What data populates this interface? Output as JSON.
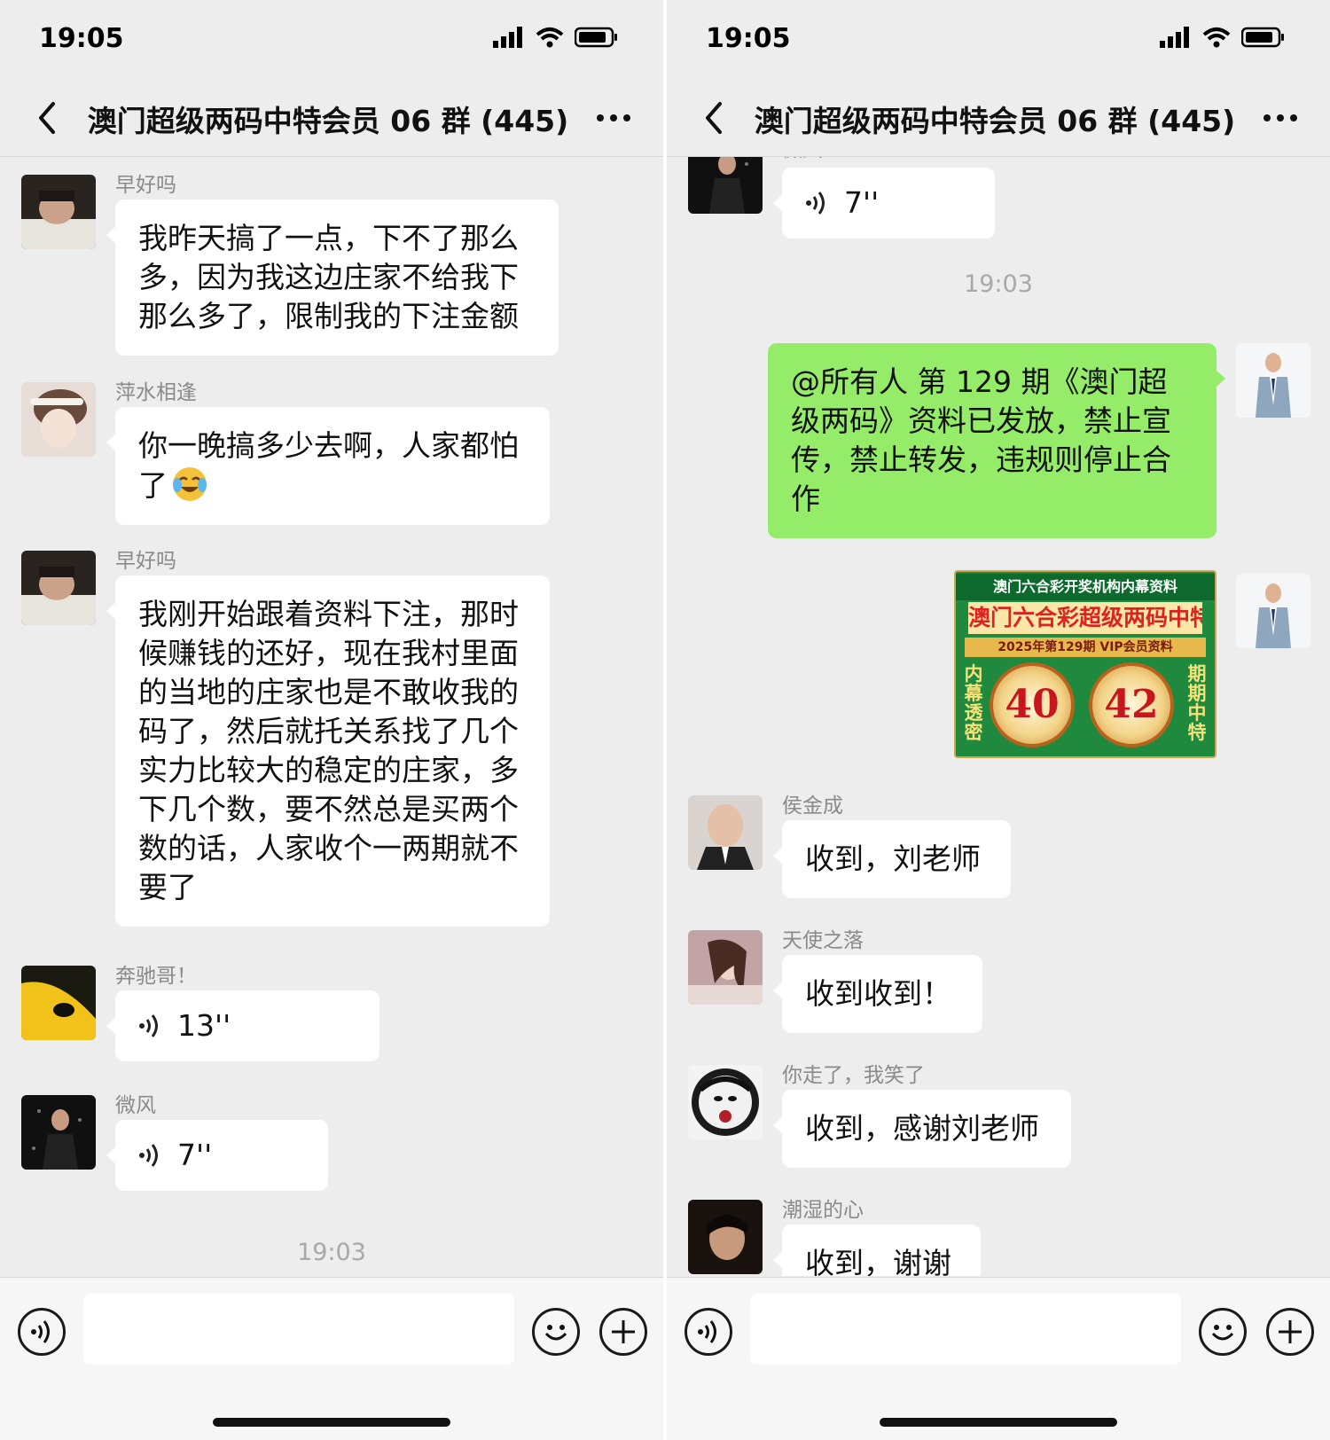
{
  "status": {
    "time": "19:05"
  },
  "header": {
    "title": "澳门超级两码中特会员 06 群 (445)"
  },
  "left": {
    "messages": [
      {
        "sender": "早好吗",
        "text": "我昨天搞了一点，下不了那么多，因为我这边庄家不给我下那么多了，限制我的下注金额"
      },
      {
        "sender": "萍水相逢",
        "text": "你一晚搞多少去啊，人家都怕了"
      },
      {
        "sender": "早好吗",
        "text": "我刚开始跟着资料下注，那时候赚钱的还好，现在我村里面的当地的庄家也是不敢收我的码了，然后就托关系找了几个实力比较大的稳定的庄家，多下几个数，要不然总是买两个数的话，人家收个一两期就不要了"
      },
      {
        "sender": "奔驰哥！",
        "voice": "13''"
      },
      {
        "sender": "微风",
        "voice": "7''"
      }
    ],
    "timestamp": "19:03"
  },
  "right": {
    "top_sender_partial": "微风",
    "top_voice": "7''",
    "timestamp": "19:03",
    "announcement": "@所有人 第 129 期《澳门超级两码》资料已发放，禁止宣传，禁止转发，违规则停止合作",
    "promo": {
      "line1": "澳门六合彩开奖机构内幕资料",
      "line2": "澳门六合彩超级两码中特",
      "line3": "2025年第129期 VIP会员资料",
      "side_left": "内幕透密",
      "side_right": "期期中特",
      "num1": "40",
      "num2": "42"
    },
    "replies": [
      {
        "sender": "侯金成",
        "text": "收到，刘老师"
      },
      {
        "sender": "天使之落",
        "text": "收到收到！"
      },
      {
        "sender": "你走了，我笑了",
        "text": "收到，感谢刘老师"
      },
      {
        "sender": "潮湿的心",
        "text": "收到，谢谢"
      }
    ]
  },
  "colors": {
    "outgoing_bubble": "#95ec69",
    "incoming_bubble": "#ffffff",
    "chat_background": "#ededed"
  },
  "icons": [
    "back-icon",
    "more-icon",
    "signal-icon",
    "wifi-icon",
    "battery-icon",
    "voice-icon",
    "emoji-icon",
    "plus-icon",
    "crying-laughing-emoji-icon"
  ]
}
